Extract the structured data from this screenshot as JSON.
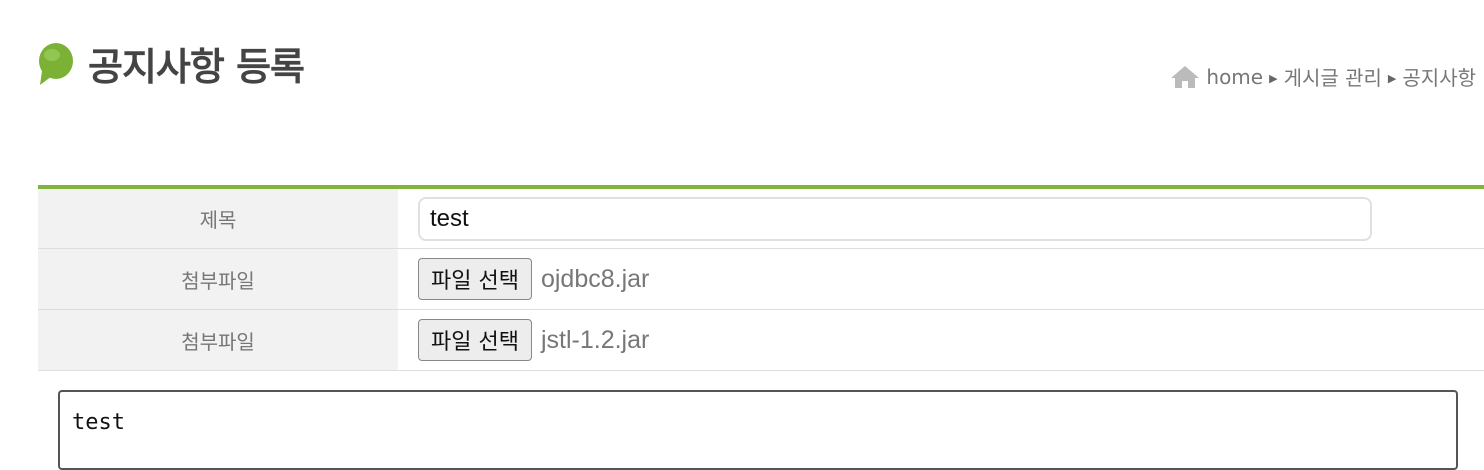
{
  "page": {
    "title": "공지사항 등록"
  },
  "breadcrumb": {
    "home": "home",
    "level1": "게시글 관리",
    "level2": "공지사항"
  },
  "form": {
    "rows": [
      {
        "label": "제목",
        "value": "test"
      },
      {
        "label": "첨부파일",
        "button": "파일 선택",
        "file": "ojdbc8.jar"
      },
      {
        "label": "첨부파일",
        "button": "파일 선택",
        "file": "jstl-1.2.jar"
      }
    ],
    "content": "test"
  },
  "colors": {
    "accent": "#7fb53a",
    "label_bg": "#f2f2f2"
  }
}
